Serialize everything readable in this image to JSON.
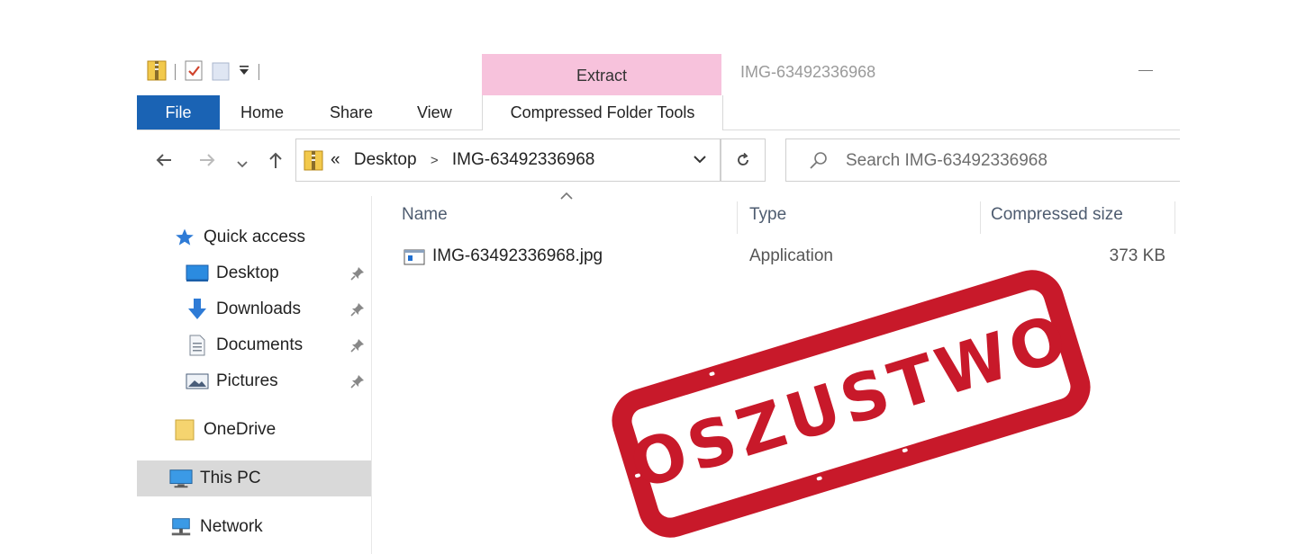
{
  "titlebar": {
    "window_title": "IMG-63492336968",
    "context_tab_header": "Extract"
  },
  "ribbon": {
    "tabs": [
      {
        "label": "File"
      },
      {
        "label": "Home"
      },
      {
        "label": "Share"
      },
      {
        "label": "View"
      },
      {
        "label": "Compressed Folder Tools"
      }
    ]
  },
  "address": {
    "overflow": "«",
    "crumbs": [
      "Desktop",
      "IMG-63492336968"
    ],
    "separator": ">"
  },
  "search": {
    "placeholder": "Search IMG-63492336968"
  },
  "navpane": {
    "items": [
      {
        "label": "Quick access",
        "icon": "star-icon"
      },
      {
        "label": "Desktop",
        "icon": "desktop-icon",
        "pinned": true
      },
      {
        "label": "Downloads",
        "icon": "download-arrow-icon",
        "pinned": true
      },
      {
        "label": "Documents",
        "icon": "document-icon",
        "pinned": true
      },
      {
        "label": "Pictures",
        "icon": "pictures-icon",
        "pinned": true
      },
      {
        "label": "OneDrive",
        "icon": "folder-icon"
      },
      {
        "label": "This PC",
        "icon": "monitor-icon",
        "selected": true
      },
      {
        "label": "Network",
        "icon": "network-icon"
      }
    ]
  },
  "filelist": {
    "columns": [
      "Name",
      "Type",
      "Compressed size"
    ],
    "rows": [
      {
        "name": "IMG-63492336968.jpg",
        "type": "Application",
        "size": "373 KB"
      }
    ]
  },
  "stamp": {
    "text": "OSZUSTWO",
    "color": "#c8192a"
  },
  "colors": {
    "file_tab": "#1a63b4",
    "context_tab": "#f7c2dc",
    "selection": "#d9d9d9"
  }
}
